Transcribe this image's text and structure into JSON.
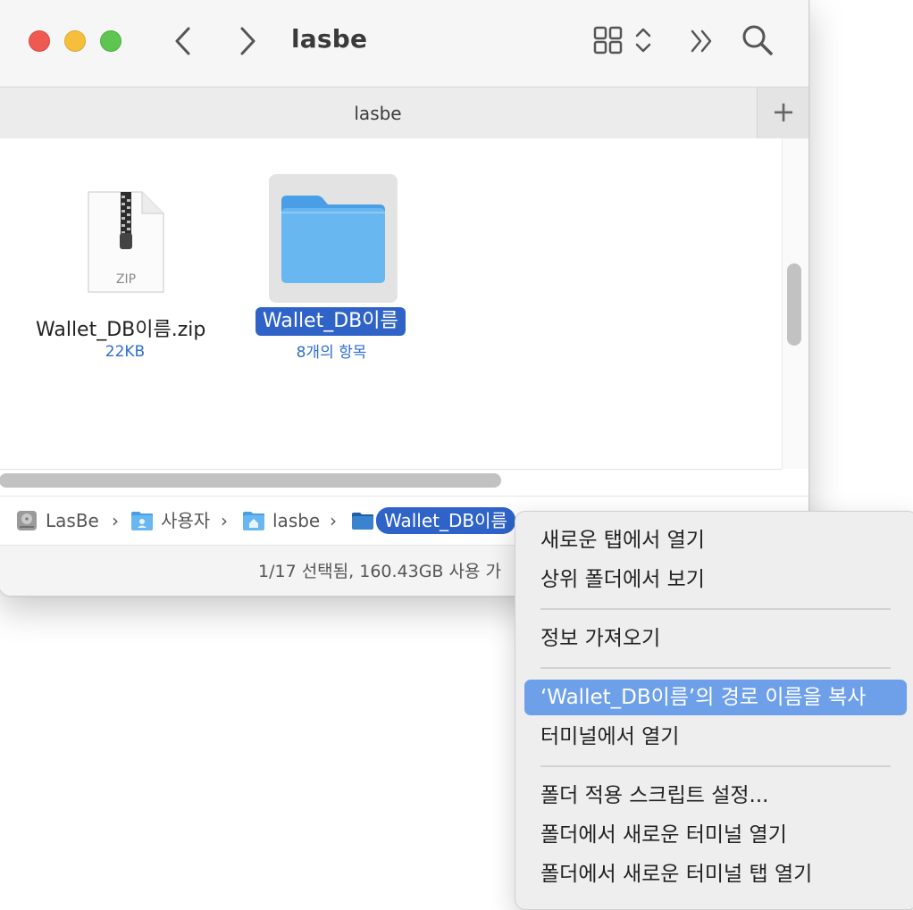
{
  "window": {
    "title": "lasbe",
    "tab_title": "lasbe",
    "tab_add": "+"
  },
  "toolbar": {
    "back_icon": "chevron-left-icon",
    "forward_icon": "chevron-right-icon",
    "view_icon": "grid-view-icon",
    "more_icon": "double-chevron-icon",
    "search_icon": "search-icon"
  },
  "items": [
    {
      "name": "Wallet_DB이름.zip",
      "meta": "22KB",
      "icon_label": "ZIP",
      "icon": "zip-file-icon"
    },
    {
      "name": "Wallet_DB이름",
      "meta": "8개의 항목",
      "icon": "folder-icon",
      "selected": true
    }
  ],
  "pathbar": {
    "crumbs": [
      {
        "label": "LasBe",
        "icon": "hard-drive-icon"
      },
      {
        "label": "사용자",
        "icon": "users-folder-icon"
      },
      {
        "label": "lasbe",
        "icon": "home-folder-icon"
      },
      {
        "label": "Wallet_DB이름",
        "icon": "folder-icon",
        "current": true
      }
    ],
    "separator": "›"
  },
  "status": {
    "text": "1/17 선택됨, 160.43GB 사용 가"
  },
  "context_menu": {
    "items": [
      {
        "label": "새로운 탭에서 열기"
      },
      {
        "label": "상위 폴더에서 보기"
      },
      {
        "label": "정보 가져오기"
      },
      {
        "label": "‘Wallet_DB이름’의 경로 이름을 복사",
        "highlighted": true
      },
      {
        "label": "터미널에서 열기"
      },
      {
        "label": "폴더 적용 스크립트 설정..."
      },
      {
        "label": "폴더에서 새로운 터미널 열기"
      },
      {
        "label": "폴더에서 새로운 터미널 탭 열기"
      }
    ]
  },
  "colors": {
    "selection": "#2f63c8",
    "menu_highlight": "#6ea0ea",
    "folder": "#69b7f1",
    "meta_text": "#2f6ed3"
  }
}
